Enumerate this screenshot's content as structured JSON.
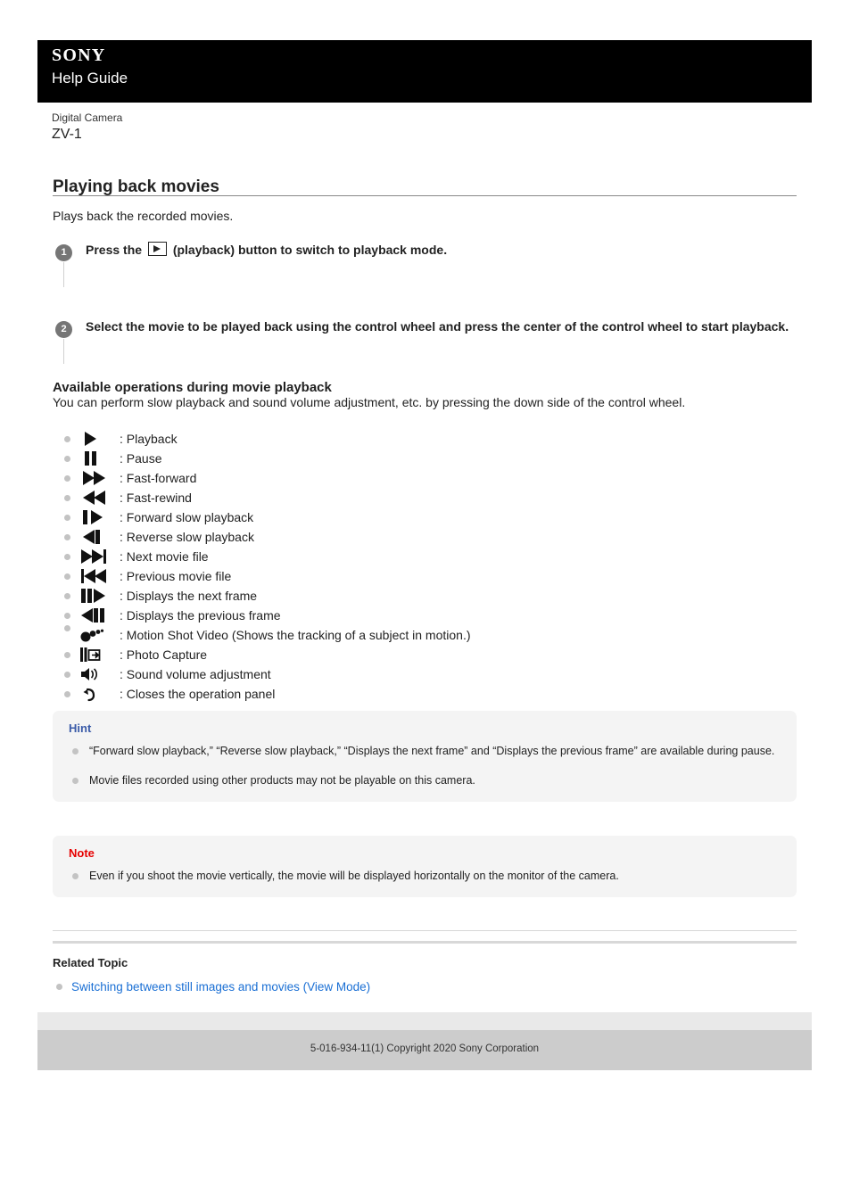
{
  "header": {
    "brand": "SONY",
    "guide_label": "Help Guide"
  },
  "product": {
    "category": "Digital Camera",
    "model": "ZV-1"
  },
  "page": {
    "title": "Playing back movies",
    "intro": "Plays back the recorded movies."
  },
  "steps": [
    {
      "number": "1",
      "text_before_icon": "Press the",
      "icon": "playback-button-icon",
      "text_after_icon": "(playback) button to switch to playback mode."
    },
    {
      "number": "2",
      "text": "Select the movie to be played back using the control wheel and press the center of the control wheel to start playback."
    }
  ],
  "section": {
    "heading": "Available operations during movie playback",
    "intro": "You can perform slow playback and sound volume adjustment, etc. by pressing the down side of the control wheel."
  },
  "operations": [
    {
      "icon": "play-icon",
      "label": ": Playback"
    },
    {
      "icon": "pause-icon",
      "label": ": Pause"
    },
    {
      "icon": "fast-forward-icon",
      "label": ": Fast-forward"
    },
    {
      "icon": "fast-rewind-icon",
      "label": ": Fast-rewind"
    },
    {
      "icon": "forward-slow-playback-icon",
      "label": ": Forward slow playback"
    },
    {
      "icon": "reverse-slow-playback-icon",
      "label": ": Reverse slow playback"
    },
    {
      "icon": "next-movie-file-icon",
      "label": ": Next movie file"
    },
    {
      "icon": "previous-movie-file-icon",
      "label": ": Previous movie file"
    },
    {
      "icon": "next-frame-icon",
      "label": ": Displays the next frame"
    },
    {
      "icon": "previous-frame-icon",
      "label": ": Displays the previous frame"
    },
    {
      "icon": "motion-shot-video-icon",
      "label": ": Motion Shot Video (Shows the tracking of a subject in motion.)"
    },
    {
      "icon": "photo-capture-icon",
      "label": ": Photo Capture"
    },
    {
      "icon": "sound-volume-icon",
      "label": ": Sound volume adjustment"
    },
    {
      "icon": "close-panel-icon",
      "label": ": Closes the operation panel"
    }
  ],
  "hint": {
    "title": "Hint",
    "items": [
      "“Forward slow playback,” “Reverse slow playback,” “Displays the next frame” and “Displays the previous frame” are available during pause.",
      "Movie files recorded using other products may not be playable on this camera."
    ]
  },
  "note": {
    "title": "Note",
    "items": [
      "Even if you shoot the movie vertically, the movie will be displayed horizontally on the monitor of the camera."
    ]
  },
  "related": {
    "title": "Related Topic",
    "links": [
      "Switching between still images and movies (View Mode)"
    ]
  },
  "footer": {
    "copyright": "5-016-934-11(1) Copyright 2020 Sony Corporation"
  },
  "colors": {
    "header_bg": "#000000",
    "hint_accent": "#3a5ba8",
    "note_accent": "#e60000",
    "link": "#1a6fd4",
    "step_badge": "#767676",
    "footer_bg": "#cccccc"
  }
}
